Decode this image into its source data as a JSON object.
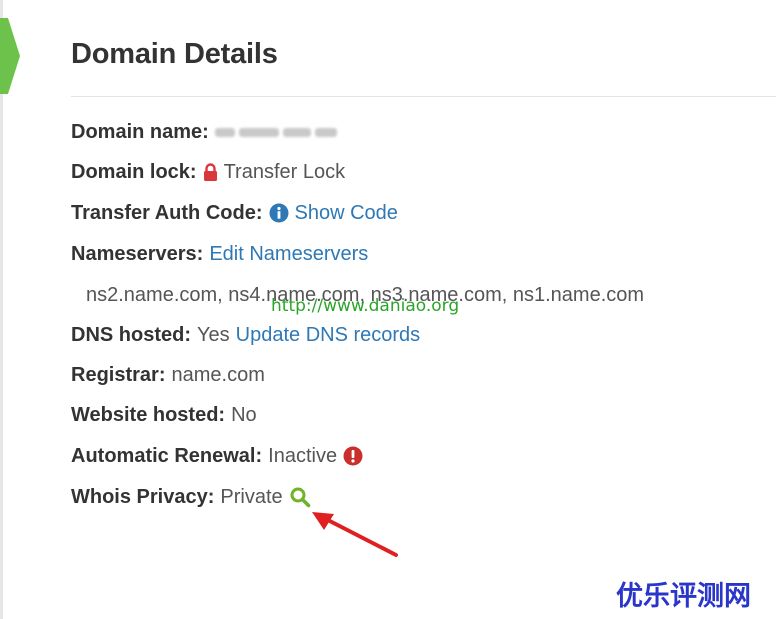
{
  "page": {
    "title": "Domain Details"
  },
  "details": {
    "domain_name_label": "Domain name:",
    "domain_lock_label": "Domain lock:",
    "domain_lock_value": "Transfer Lock",
    "auth_code_label": "Transfer Auth Code:",
    "auth_code_link": "Show Code",
    "nameservers_label": "Nameservers:",
    "nameservers_link": "Edit Nameservers",
    "nameservers_list": "ns2.name.com, ns4.name.com, ns3.name.com, ns1.name.com",
    "dns_hosted_label": "DNS hosted:",
    "dns_hosted_value": "Yes",
    "dns_link": "Update DNS records",
    "registrar_label": "Registrar:",
    "registrar_value": "name.com",
    "website_hosted_label": "Website hosted:",
    "website_hosted_value": "No",
    "auto_renewal_label": "Automatic Renewal:",
    "auto_renewal_value": "Inactive",
    "whois_label": "Whois Privacy:",
    "whois_value": "Private"
  },
  "overlay": {
    "watermark": "http://www.daniao.org",
    "brand": "优乐评测网"
  },
  "icons": {
    "lock": "lock-icon",
    "info": "info-icon",
    "warning": "exclamation-icon",
    "search": "search-icon",
    "annotation": "red-arrow"
  },
  "colors": {
    "link": "#2d78b5",
    "lock": "#d9363e",
    "warning": "#c9302c",
    "search": "#6fb32a",
    "step_arrow": "#6cc24a",
    "annotation_arrow": "#e02020",
    "brand": "#2a35c9",
    "watermark": "#2aa52a"
  }
}
